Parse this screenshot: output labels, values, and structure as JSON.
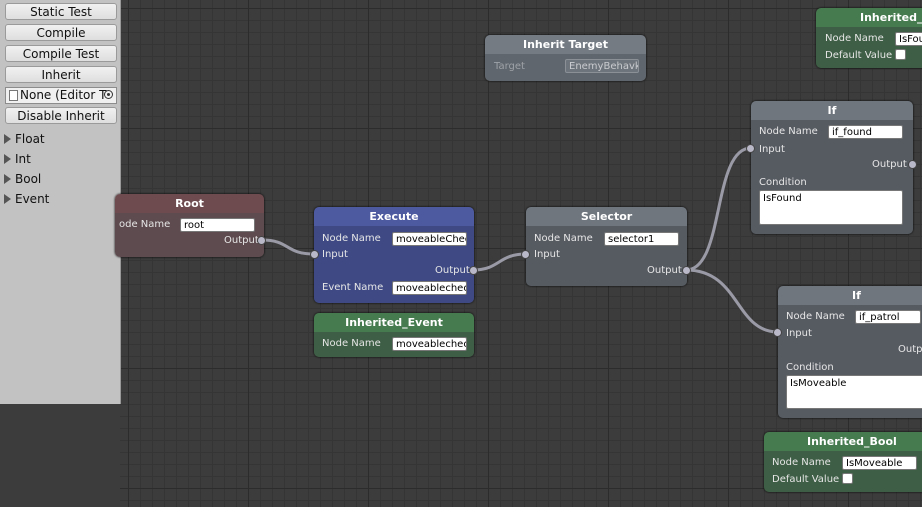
{
  "sidebar": {
    "buttons": {
      "static_test": "Static Test",
      "compile": "Compile",
      "compile_test": "Compile Test",
      "inherit": "Inherit",
      "disable_inherit": "Disable Inherit"
    },
    "object_field": "None (Editor T",
    "foldouts": [
      "Float",
      "Int",
      "Bool",
      "Event"
    ]
  },
  "nodes": {
    "inherit_target": {
      "title": "Inherit Target",
      "target_label": "Target",
      "target_value": "EnemyBehavk"
    },
    "inherited_bool_top": {
      "title": "Inherited_Bo",
      "node_name_label": "Node Name",
      "node_name_value": "IsFou",
      "default_value_label": "Default Value"
    },
    "if_found": {
      "title": "If",
      "node_name_label": "Node Name",
      "node_name_value": "if_found",
      "input_label": "Input",
      "output_label": "Output",
      "condition_label": "Condition",
      "condition_value": "IsFound"
    },
    "root": {
      "title": "Root",
      "node_name_label": "ode Name",
      "node_name_value": "root",
      "output_label": "Output"
    },
    "execute": {
      "title": "Execute",
      "node_name_label": "Node Name",
      "node_name_value": "moveableChec",
      "input_label": "Input",
      "output_label": "Output",
      "event_name_label": "Event Name",
      "event_name_value": "moveablechec"
    },
    "selector": {
      "title": "Selector",
      "node_name_label": "Node Name",
      "node_name_value": "selector1",
      "input_label": "Input",
      "output_label": "Output"
    },
    "inherited_event": {
      "title": "Inherited_Event",
      "node_name_label": "Node Name",
      "node_name_value": "moveablechec"
    },
    "if_patrol": {
      "title": "If",
      "node_name_label": "Node Name",
      "node_name_value": "if_patrol",
      "input_label": "Input",
      "output_label": "Outp",
      "condition_label": "Condition",
      "condition_value": "IsMoveable"
    },
    "inherited_bool": {
      "title": "Inherited_Bool",
      "node_name_label": "Node Name",
      "node_name_value": "IsMoveable",
      "default_value_label": "Default Value"
    }
  },
  "colors": {
    "root": "#6e4b4f",
    "execute": "#4e5aa0",
    "inherited": "#467a4f",
    "selector": "#6f767e",
    "canvas": "#3c3c3c",
    "wire": "#9a9aa6"
  }
}
